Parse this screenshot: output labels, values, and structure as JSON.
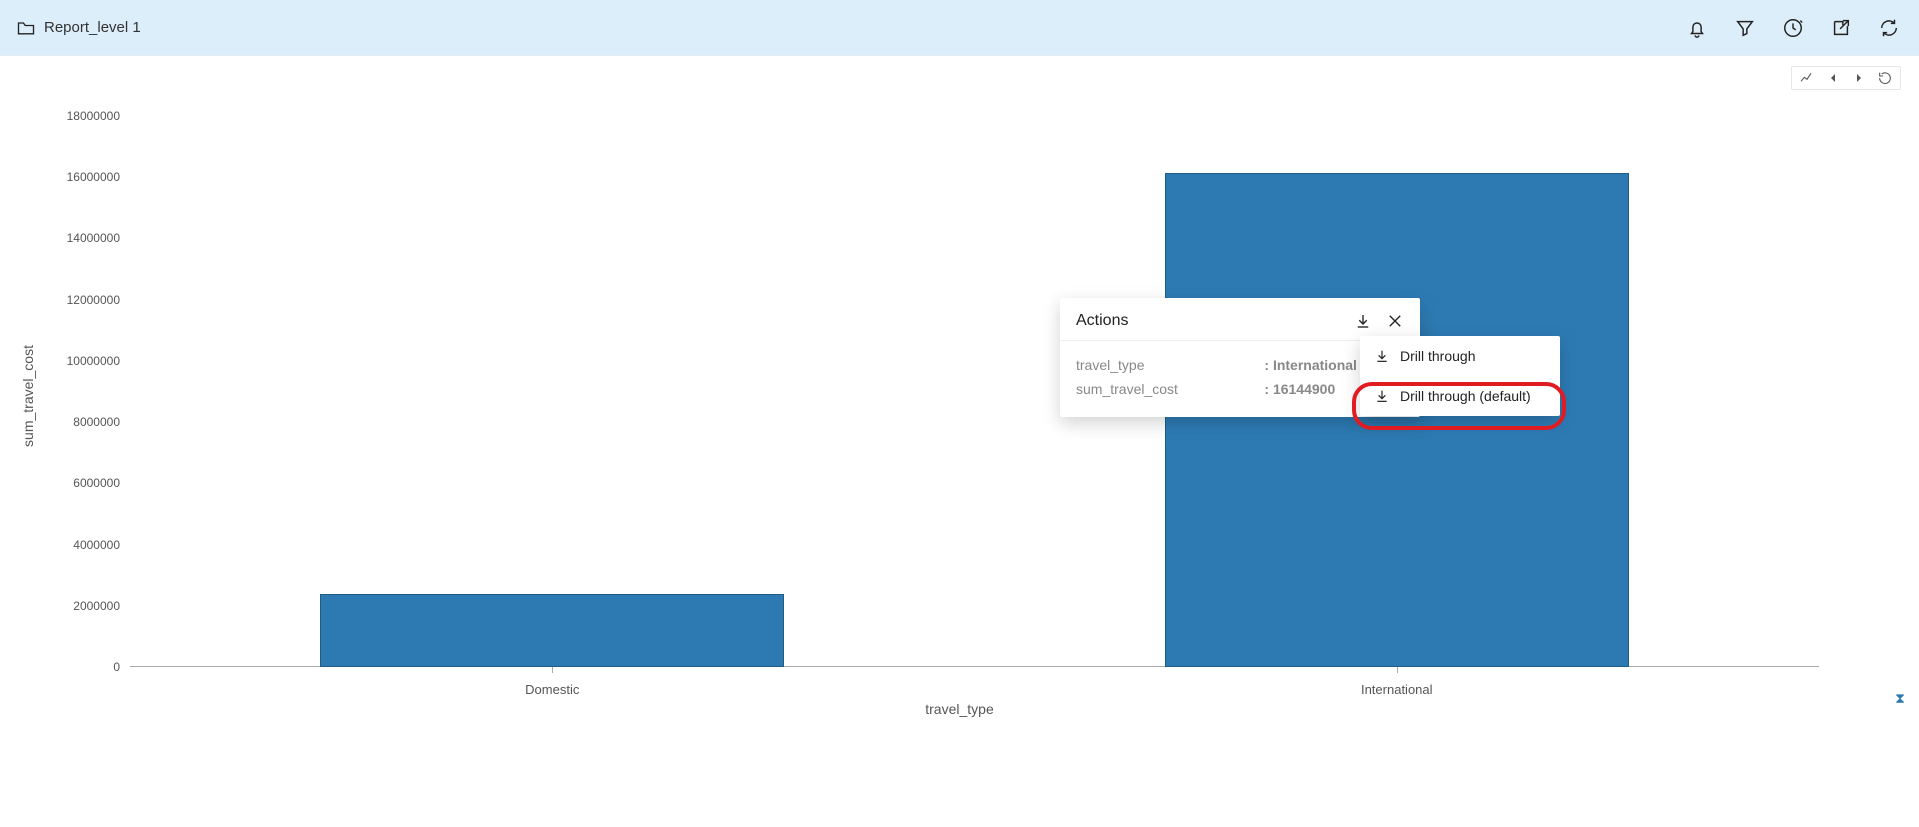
{
  "header": {
    "title": "Report_level 1"
  },
  "chart_data": {
    "type": "bar",
    "categories": [
      "Domestic",
      "International"
    ],
    "values": [
      2400000,
      16144900
    ],
    "xlabel": "travel_type",
    "ylabel": "sum_travel_cost",
    "ylim": [
      0,
      18000000
    ],
    "yticks": [
      0,
      2000000,
      4000000,
      6000000,
      8000000,
      10000000,
      12000000,
      14000000,
      16000000,
      18000000
    ]
  },
  "actions_panel": {
    "title": "Actions",
    "rows": [
      {
        "key": "travel_type",
        "value": ": International"
      },
      {
        "key": "sum_travel_cost",
        "value": ": 16144900"
      }
    ]
  },
  "submenu": {
    "items": [
      {
        "label": "Drill through"
      },
      {
        "label": "Drill through (default)"
      }
    ]
  }
}
